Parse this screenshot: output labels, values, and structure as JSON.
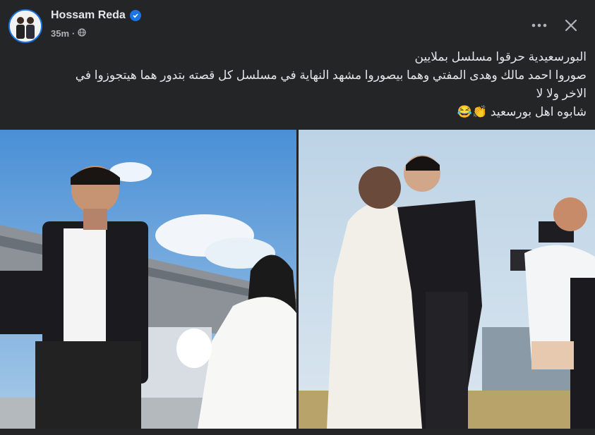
{
  "post": {
    "author": "Hossam Reda",
    "time": "35m",
    "privacy_icon": "globe-icon",
    "verified_icon": "verified-badge-icon",
    "text_lines": [
      "البورسعيدية حرقوا مسلسل بملايين",
      "صوروا احمد مالك وهدى المفتي وهما بيصوروا مشهد النهاية في مسلسل كل قصته بتدور هما هيتجوزوا في",
      "الاخر ولا لا",
      "شابوه اهل بورسعيد 👏😂"
    ]
  },
  "header_actions": {
    "more_icon": "more-options-icon",
    "close_icon": "close-icon"
  },
  "media": {
    "photos": [
      "photo-left",
      "photo-right"
    ]
  },
  "colors": {
    "background": "#242526",
    "text": "#e4e6eb",
    "secondary": "#b0b3b8",
    "accent": "#1b74e4"
  }
}
